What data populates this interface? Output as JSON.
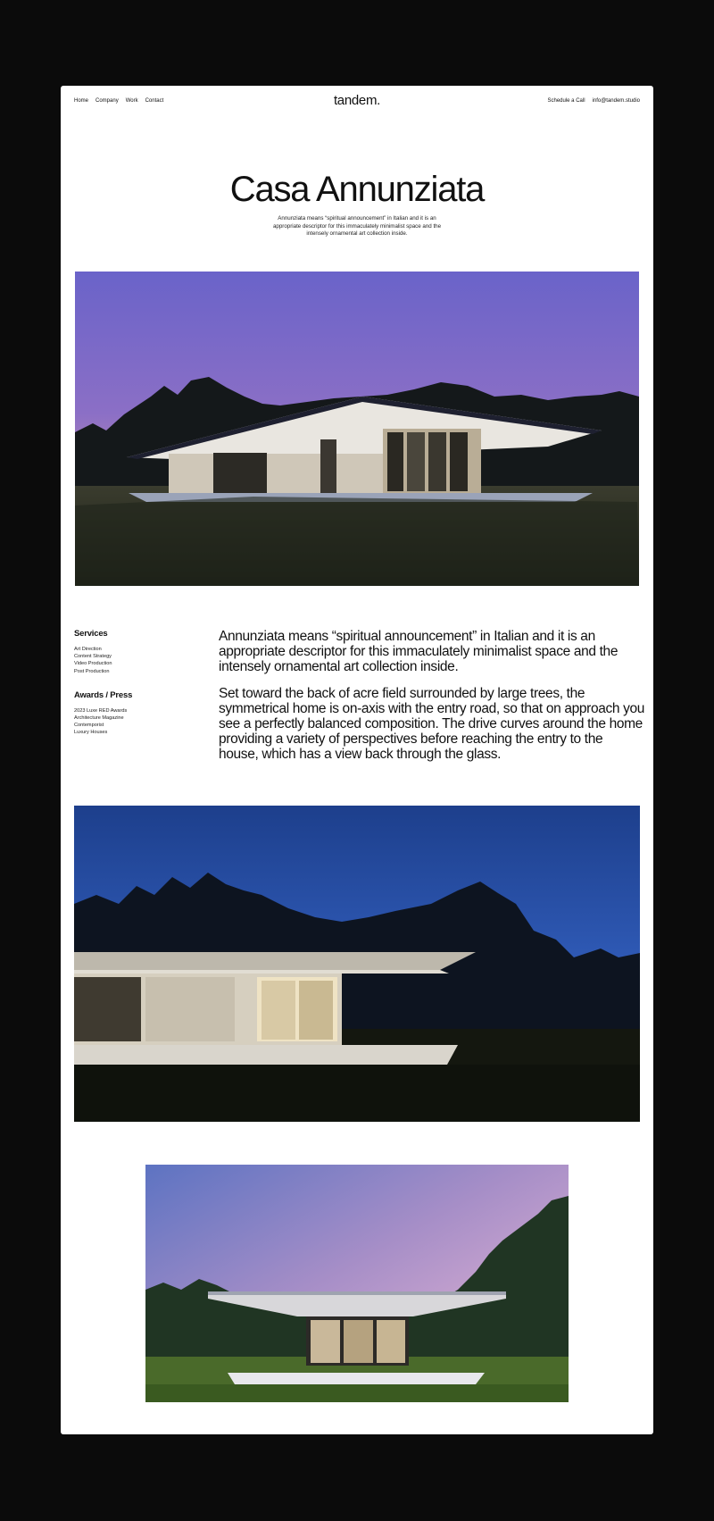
{
  "nav": {
    "links": [
      "Home",
      "Company",
      "Work",
      "Contact"
    ],
    "logo": "tandem.",
    "schedule_label": "Schedule a Call",
    "email": "info@tandem.studio"
  },
  "hero": {
    "title": "Casa Annunziata",
    "subtitle": "Annunziata means “spiritual announcement” in Italian and it is an appropriate descriptor for this immaculately minimalist space and the intensely ornamental art collection inside."
  },
  "sidebar": {
    "services_heading": "Services",
    "services": [
      "Art Direction",
      "Content Strategy",
      "Video Production",
      "Post Production"
    ],
    "awards_heading": "Awards / Press",
    "awards": [
      "2023 Luxe RED Awards",
      "Architecture Magazine",
      "Contemporist",
      "Luxury Houses"
    ]
  },
  "body": {
    "paragraphs": [
      "Annunziata means “spiritual announcement” in Italian and it is an appropriate descriptor for this immaculately minimalist space and the intensely ornamental art collection inside.",
      "Set toward the back of acre field surrounded by large trees, the symmetrical home is on-axis with the entry road, so that on approach you see a perfectly balanced composition. The drive curves around the home providing a variety of perspectives before reaching the entry to the house, which has a view back through the glass."
    ]
  },
  "images": {
    "photo_1": "house-dusk-wide-photo",
    "photo_2": "house-night-blue-photo",
    "photo_3": "house-front-twilight-photo"
  },
  "colors": {
    "background": "#0b0b0b",
    "page": "#ffffff",
    "text": "#111111"
  }
}
